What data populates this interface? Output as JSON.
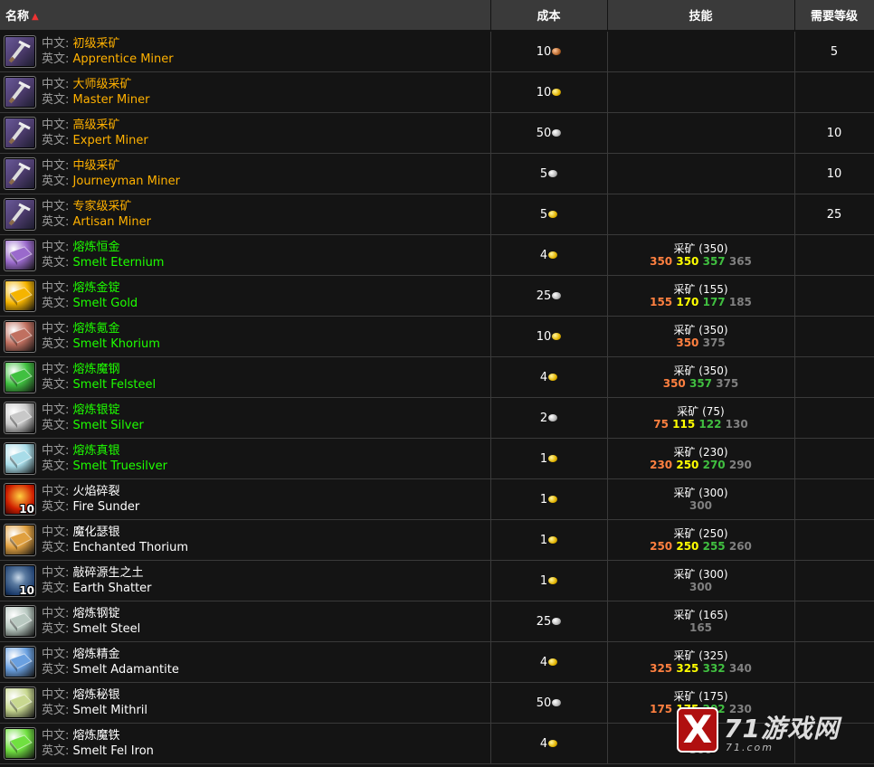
{
  "header": {
    "name": "名称",
    "cost": "成本",
    "skill": "技能",
    "level": "需要等级"
  },
  "labels": {
    "cn": "中文:",
    "en": "英文:"
  },
  "rows": [
    {
      "cn": "初级采矿",
      "en": "Apprentice Miner",
      "quality": "orange",
      "icon": "pickaxe-icon",
      "cost": "10",
      "coin": "copper",
      "skill_name": "",
      "skill_nums": [],
      "level": "5"
    },
    {
      "cn": "大师级采矿",
      "en": "Master Miner",
      "quality": "orange",
      "icon": "pickaxe-icon",
      "cost": "10",
      "coin": "gold",
      "skill_name": "",
      "skill_nums": [],
      "level": ""
    },
    {
      "cn": "高级采矿",
      "en": "Expert Miner",
      "quality": "orange",
      "icon": "pickaxe-icon",
      "cost": "50",
      "coin": "silver",
      "skill_name": "",
      "skill_nums": [],
      "level": "10"
    },
    {
      "cn": "中级采矿",
      "en": "Journeyman Miner",
      "quality": "orange",
      "icon": "pickaxe-icon",
      "cost": "5",
      "coin": "silver",
      "skill_name": "",
      "skill_nums": [],
      "level": "10"
    },
    {
      "cn": "专家级采矿",
      "en": "Artisan Miner",
      "quality": "orange",
      "icon": "pickaxe-icon",
      "cost": "5",
      "coin": "gold",
      "skill_name": "",
      "skill_nums": [],
      "level": "25"
    },
    {
      "cn": "熔炼恒金",
      "en": "Smelt Eternium",
      "quality": "green",
      "icon": "eternium-bar-icon",
      "cost": "4",
      "coin": "gold",
      "skill_name": "采矿 (350)",
      "skill_nums": [
        "350",
        "350",
        "357",
        "365"
      ],
      "level": ""
    },
    {
      "cn": "熔炼金锭",
      "en": "Smelt Gold",
      "quality": "green",
      "icon": "gold-bar-icon",
      "cost": "25",
      "coin": "silver",
      "skill_name": "采矿 (155)",
      "skill_nums": [
        "155",
        "170",
        "177",
        "185"
      ],
      "level": ""
    },
    {
      "cn": "熔炼氪金",
      "en": "Smelt Khorium",
      "quality": "green",
      "icon": "khorium-bar-icon",
      "cost": "10",
      "coin": "gold",
      "skill_name": "采矿 (350)",
      "skill_nums": [
        "350",
        "375"
      ],
      "level": ""
    },
    {
      "cn": "熔炼魔钢",
      "en": "Smelt Felsteel",
      "quality": "green",
      "icon": "felsteel-bar-icon",
      "cost": "4",
      "coin": "gold",
      "skill_name": "采矿 (350)",
      "skill_nums": [
        "350",
        "357",
        "375"
      ],
      "level": ""
    },
    {
      "cn": "熔炼银锭",
      "en": "Smelt Silver",
      "quality": "green",
      "icon": "silver-bar-icon",
      "cost": "2",
      "coin": "silver",
      "skill_name": "采矿 (75)",
      "skill_nums": [
        "75",
        "115",
        "122",
        "130"
      ],
      "level": ""
    },
    {
      "cn": "熔炼真银",
      "en": "Smelt Truesilver",
      "quality": "green",
      "icon": "truesilver-bar-icon",
      "cost": "1",
      "coin": "gold",
      "skill_name": "采矿 (230)",
      "skill_nums": [
        "230",
        "250",
        "270",
        "290"
      ],
      "level": ""
    },
    {
      "cn": "火焰碎裂",
      "en": "Fire Sunder",
      "quality": "white",
      "icon": "fire-icon",
      "icon_count": "10",
      "cost": "1",
      "coin": "gold",
      "skill_name": "采矿 (300)",
      "skill_nums": [
        "300"
      ],
      "level": ""
    },
    {
      "cn": "魔化瑟银",
      "en": "Enchanted Thorium",
      "quality": "white",
      "icon": "enchanted-thorium-icon",
      "cost": "1",
      "coin": "gold",
      "skill_name": "采矿 (250)",
      "skill_nums": [
        "250",
        "250",
        "255",
        "260"
      ],
      "level": ""
    },
    {
      "cn": "敲碎源生之土",
      "en": "Earth Shatter",
      "quality": "white",
      "icon": "earth-icon",
      "icon_count": "10",
      "cost": "1",
      "coin": "gold",
      "skill_name": "采矿 (300)",
      "skill_nums": [
        "300"
      ],
      "level": ""
    },
    {
      "cn": "熔炼钢锭",
      "en": "Smelt Steel",
      "quality": "white",
      "icon": "steel-bar-icon",
      "cost": "25",
      "coin": "silver",
      "skill_name": "采矿 (165)",
      "skill_nums": [
        "165"
      ],
      "level": ""
    },
    {
      "cn": "熔炼精金",
      "en": "Smelt Adamantite",
      "quality": "white",
      "icon": "adamantite-bar-icon",
      "cost": "4",
      "coin": "gold",
      "skill_name": "采矿 (325)",
      "skill_nums": [
        "325",
        "325",
        "332",
        "340"
      ],
      "level": ""
    },
    {
      "cn": "熔炼秘银",
      "en": "Smelt Mithril",
      "quality": "white",
      "icon": "mithril-bar-icon",
      "cost": "50",
      "coin": "silver",
      "skill_name": "采矿 (175)",
      "skill_nums": [
        "175",
        "175",
        "202",
        "230"
      ],
      "level": ""
    },
    {
      "cn": "熔炼魔铁",
      "en": "Smelt Fel Iron",
      "quality": "white",
      "icon": "fel-iron-bar-icon",
      "cost": "4",
      "coin": "gold",
      "skill_name": "采矿",
      "skill_nums": [
        "300"
      ],
      "level": ""
    }
  ],
  "icon_colors": {
    "pickaxe-icon": "#4a3a6a",
    "eternium-bar-icon": "#9a6acc",
    "gold-bar-icon": "#f5b400",
    "khorium-bar-icon": "#c07060",
    "felsteel-bar-icon": "#40c040",
    "silver-bar-icon": "#c8c8c8",
    "truesilver-bar-icon": "#a8dce8",
    "fire-icon": "#d02000",
    "enchanted-thorium-icon": "#e0a040",
    "earth-icon": "#1a3a6a",
    "steel-bar-icon": "#b8c8c0",
    "adamantite-bar-icon": "#6aa0e0",
    "mithril-bar-icon": "#c8d890",
    "fel-iron-bar-icon": "#70e040"
  },
  "watermark": {
    "mark": "X",
    "text": "71游戏网",
    "url": "71.com"
  }
}
